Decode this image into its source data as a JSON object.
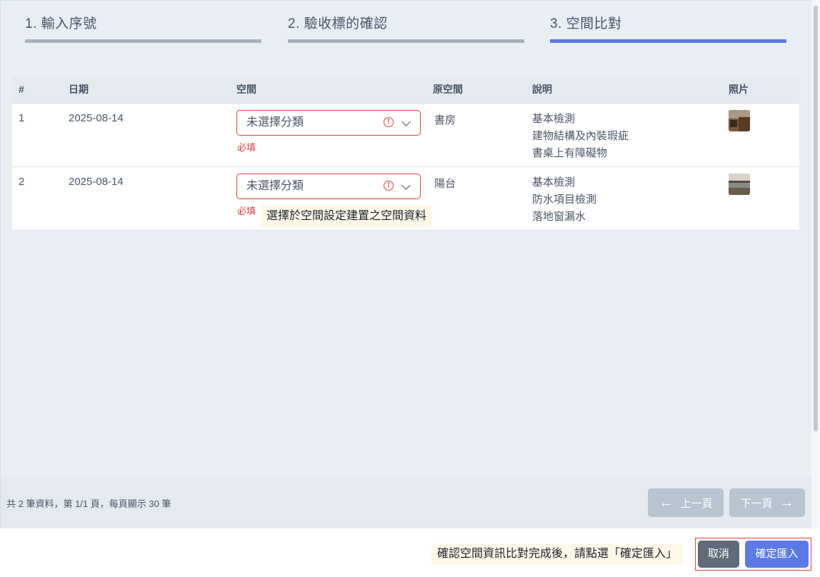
{
  "steps": [
    {
      "label": "1. 輸入序號",
      "active": false
    },
    {
      "label": "2. 驗收標的確認",
      "active": false
    },
    {
      "label": "3. 空間比對",
      "active": true
    }
  ],
  "table": {
    "headers": {
      "num": "#",
      "date": "日期",
      "space": "空間",
      "original_space": "原空間",
      "description": "說明",
      "photo": "照片"
    },
    "rows": [
      {
        "num": "1",
        "date": "2025-08-14",
        "space_select": "未選擇分類",
        "required": "必填",
        "original_space": "書房",
        "description": [
          "基本檢測",
          "建物結構及內裝瑕疵",
          "書桌上有障礙物"
        ],
        "photo_icon": "photo-thumbnail"
      },
      {
        "num": "2",
        "date": "2025-08-14",
        "space_select": "未選擇分類",
        "required": "必填",
        "original_space": "陽台",
        "description": [
          "基本檢測",
          "防水項目檢測",
          "落地窗漏水"
        ],
        "photo_icon": "photo-thumbnail"
      }
    ]
  },
  "tooltips": {
    "space_hint": "選擇於空間設定建置之空間資料",
    "confirm_hint": "確認空間資訊比對完成後，請點選「確定匯入」"
  },
  "pagination": {
    "info": "共 2 筆資料，第 1/1 頁，每頁顯示 30 筆",
    "prev": "上一頁",
    "next": "下一頁"
  },
  "actions": {
    "cancel": "取消",
    "confirm": "確定匯入"
  },
  "colors": {
    "accent": "#5b7ae8",
    "error": "#e53e3e",
    "tooltip_bg": "#fdf8e6"
  }
}
